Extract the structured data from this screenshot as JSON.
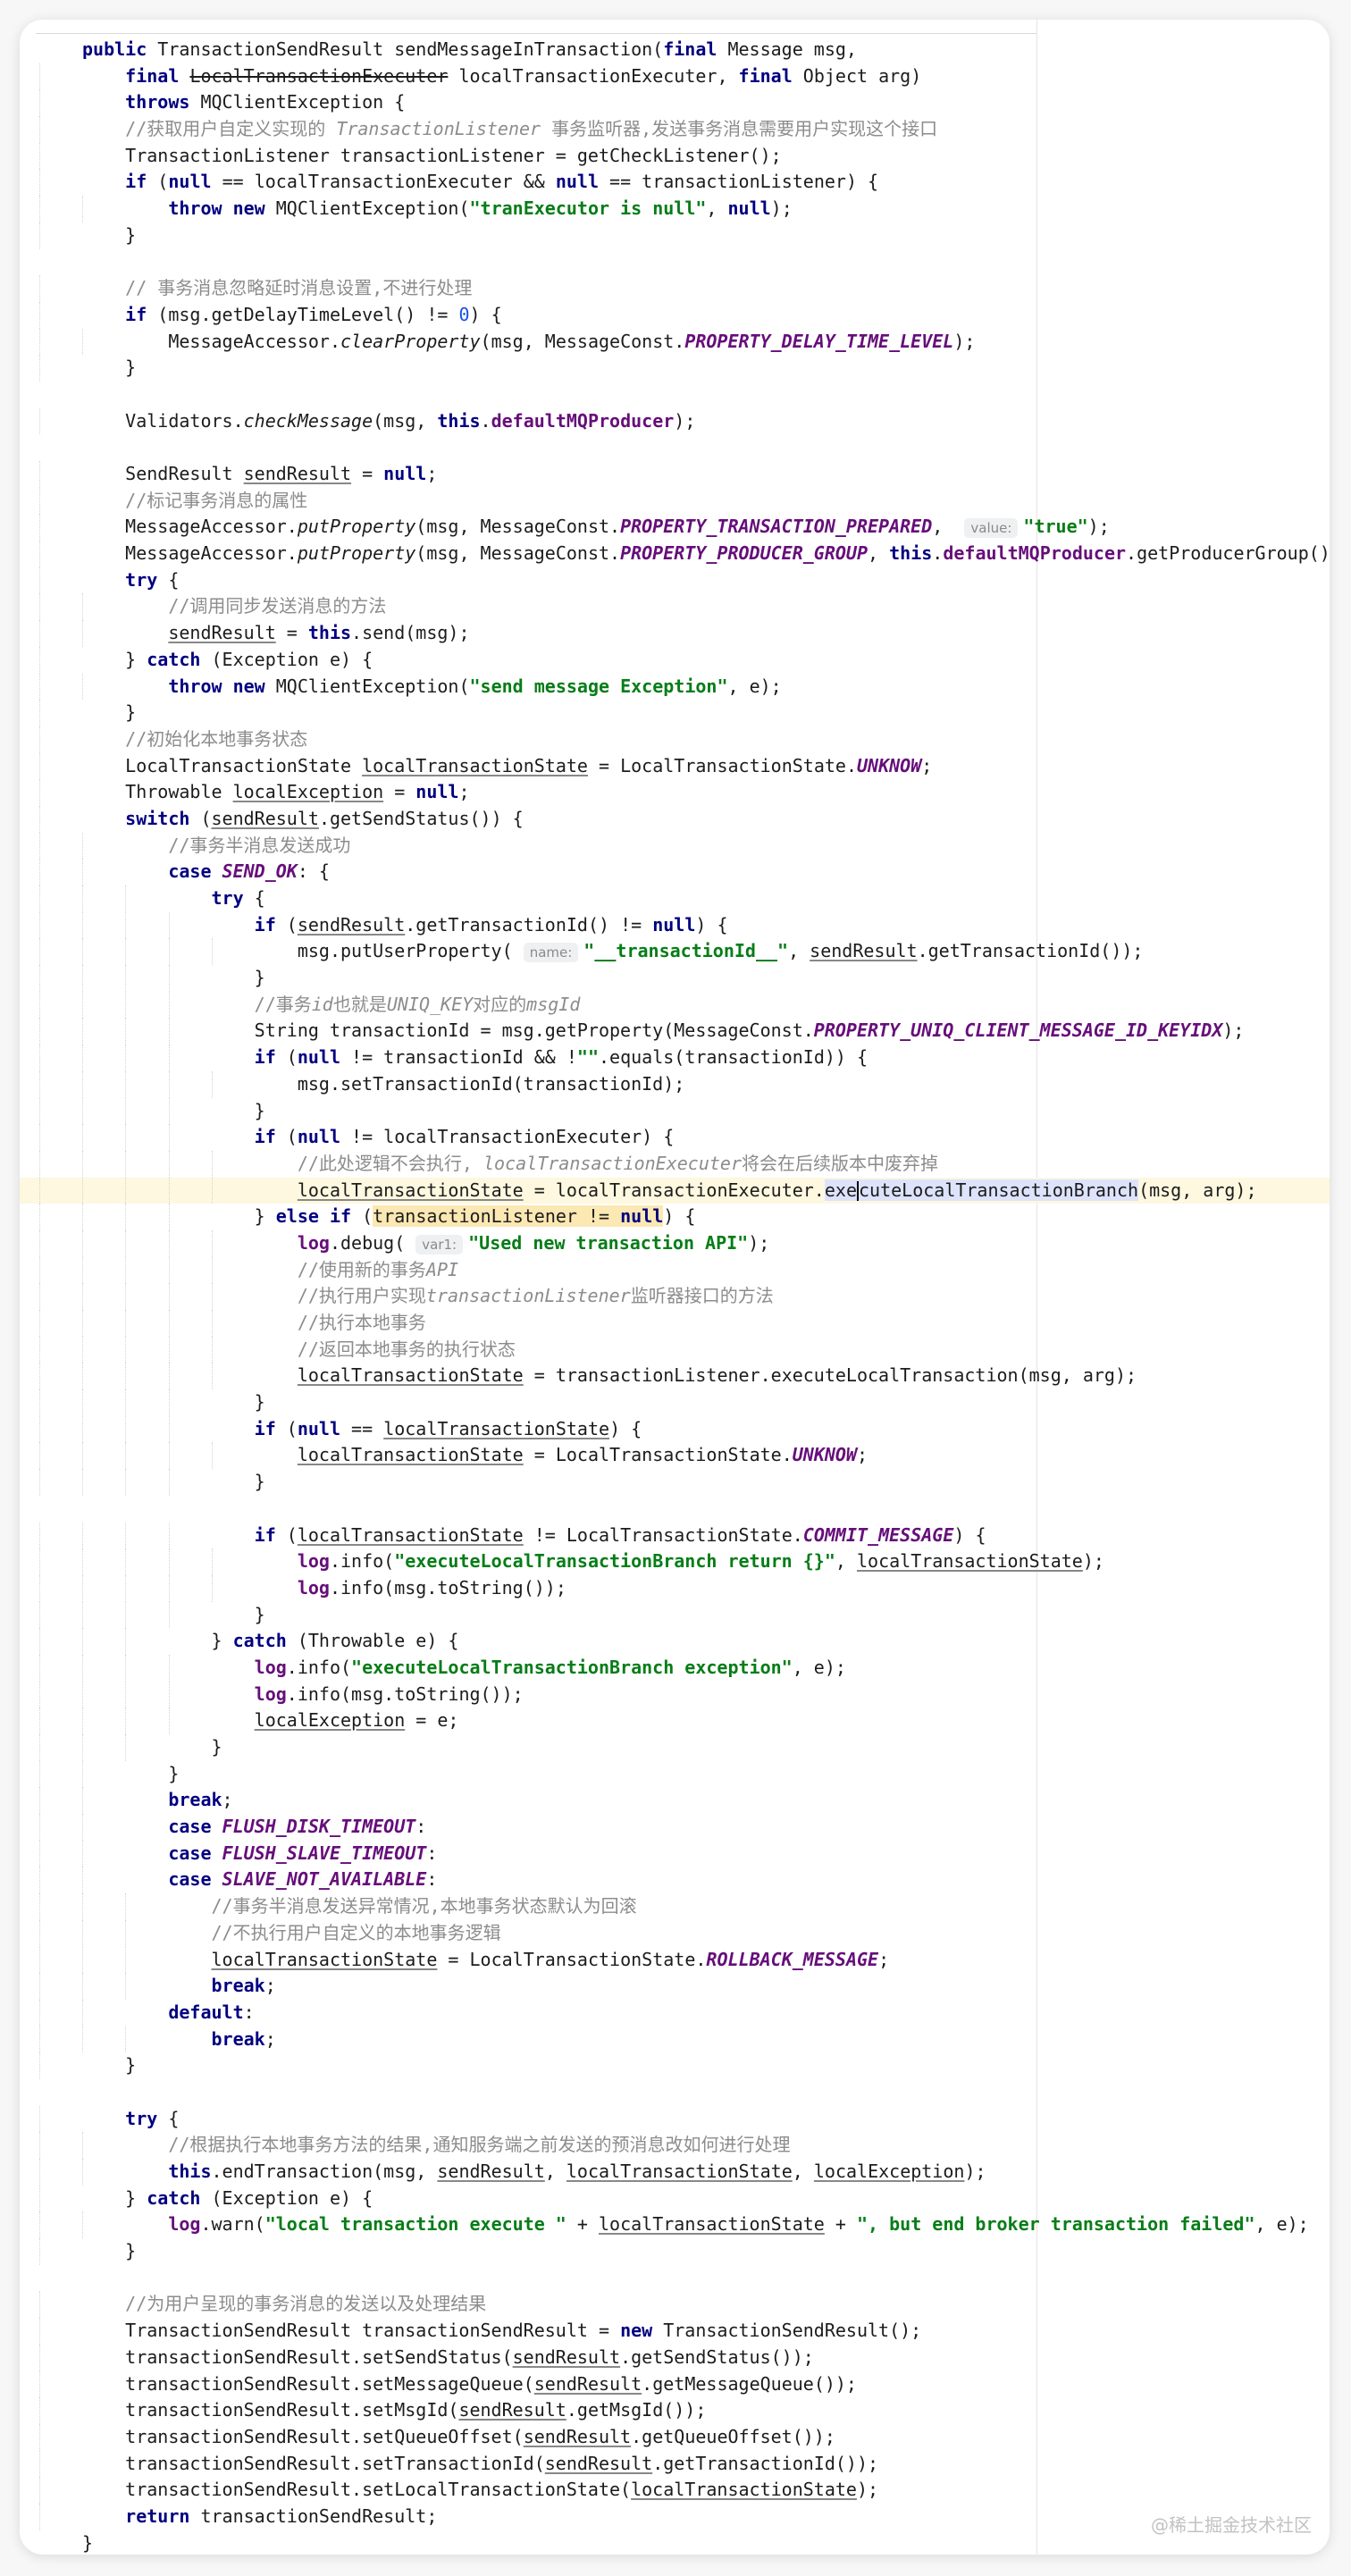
{
  "watermark": "@稀土掘金技术社区",
  "code": {
    "lines": [
      "public TransactionSendResult sendMessageInTransaction(final Message msg,",
      "    final LocalTransactionExecuter localTransactionExecuter, final Object arg)",
      "    throws MQClientException {",
      "    //获取用户自定义实现的 TransactionListener 事务监听器,发送事务消息需要用户实现这个接口",
      "    TransactionListener transactionListener = getCheckListener();",
      "    if (null == localTransactionExecuter && null == transactionListener) {",
      "        throw new MQClientException(\"tranExecutor is null\", null);",
      "    }",
      "",
      "    // 事务消息忽略延时消息设置,不进行处理",
      "    if (msg.getDelayTimeLevel() != 0) {",
      "        MessageAccessor.clearProperty(msg, MessageConst.PROPERTY_DELAY_TIME_LEVEL);",
      "    }",
      "",
      "    Validators.checkMessage(msg, this.defaultMQProducer);",
      "",
      "    SendResult sendResult = null;",
      "    //标记事务消息的属性",
      "    MessageAccessor.putProperty(msg, MessageConst.PROPERTY_TRANSACTION_PREPARED,  value: \"true\");",
      "    MessageAccessor.putProperty(msg, MessageConst.PROPERTY_PRODUCER_GROUP, this.defaultMQProducer.getProducerGroup());",
      "    try {",
      "        //调用同步发送消息的方法",
      "        sendResult = this.send(msg);",
      "    } catch (Exception e) {",
      "        throw new MQClientException(\"send message Exception\", e);",
      "    }",
      "    //初始化本地事务状态",
      "    LocalTransactionState localTransactionState = LocalTransactionState.UNKNOW;",
      "    Throwable localException = null;",
      "    switch (sendResult.getSendStatus()) {",
      "        //事务半消息发送成功",
      "        case SEND_OK: {",
      "            try {",
      "                if (sendResult.getTransactionId() != null) {",
      "                    msg.putUserProperty( name: \"__transactionId__\", sendResult.getTransactionId());",
      "                }",
      "                //事务id也就是UNIQ_KEY对应的msgId",
      "                String transactionId = msg.getProperty(MessageConst.PROPERTY_UNIQ_CLIENT_MESSAGE_ID_KEYIDX);",
      "                if (null != transactionId && !\"\".equals(transactionId)) {",
      "                    msg.setTransactionId(transactionId);",
      "                }",
      "                if (null != localTransactionExecuter) {",
      "                    //此处逻辑不会执行, localTransactionExecuter将会在后续版本中废弃掉",
      "                    localTransactionState = localTransactionExecuter.executeLocalTransactionBranch(msg, arg);",
      "                } else if (transactionListener != null) {",
      "                    log.debug( var1: \"Used new transaction API\");",
      "                    //使用新的事务API",
      "                    //执行用户实现transactionListener监听器接口的方法",
      "                    //执行本地事务",
      "                    //返回本地事务的执行状态",
      "                    localTransactionState = transactionListener.executeLocalTransaction(msg, arg);",
      "                }",
      "                if (null == localTransactionState) {",
      "                    localTransactionState = LocalTransactionState.UNKNOW;",
      "                }",
      "",
      "                if (localTransactionState != LocalTransactionState.COMMIT_MESSAGE) {",
      "                    log.info(\"executeLocalTransactionBranch return {}\", localTransactionState);",
      "                    log.info(msg.toString());",
      "                }",
      "            } catch (Throwable e) {",
      "                log.info(\"executeLocalTransactionBranch exception\", e);",
      "                log.info(msg.toString());",
      "                localException = e;",
      "            }",
      "        }",
      "        break;",
      "        case FLUSH_DISK_TIMEOUT:",
      "        case FLUSH_SLAVE_TIMEOUT:",
      "        case SLAVE_NOT_AVAILABLE:",
      "            //事务半消息发送异常情况,本地事务状态默认为回滚",
      "            //不执行用户自定义的本地事务逻辑",
      "            localTransactionState = LocalTransactionState.ROLLBACK_MESSAGE;",
      "            break;",
      "        default:",
      "            break;",
      "    }",
      "",
      "    try {",
      "        //根据执行本地事务方法的结果,通知服务端之前发送的预消息改如何进行处理",
      "        this.endTransaction(msg, sendResult, localTransactionState, localException);",
      "    } catch (Exception e) {",
      "        log.warn(\"local transaction execute \" + localTransactionState + \", but end broker transaction failed\", e);",
      "    }",
      "",
      "    //为用户呈现的事务消息的发送以及处理结果",
      "    TransactionSendResult transactionSendResult = new TransactionSendResult();",
      "    transactionSendResult.setSendStatus(sendResult.getSendStatus());",
      "    transactionSendResult.setMessageQueue(sendResult.getMessageQueue());",
      "    transactionSendResult.setMsgId(sendResult.getMsgId());",
      "    transactionSendResult.setQueueOffset(sendResult.getQueueOffset());",
      "    transactionSendResult.setTransactionId(sendResult.getTransactionId());",
      "    transactionSendResult.setLocalTransactionState(localTransactionState);",
      "    return transactionSendResult;",
      "}"
    ],
    "current_line": 43
  }
}
